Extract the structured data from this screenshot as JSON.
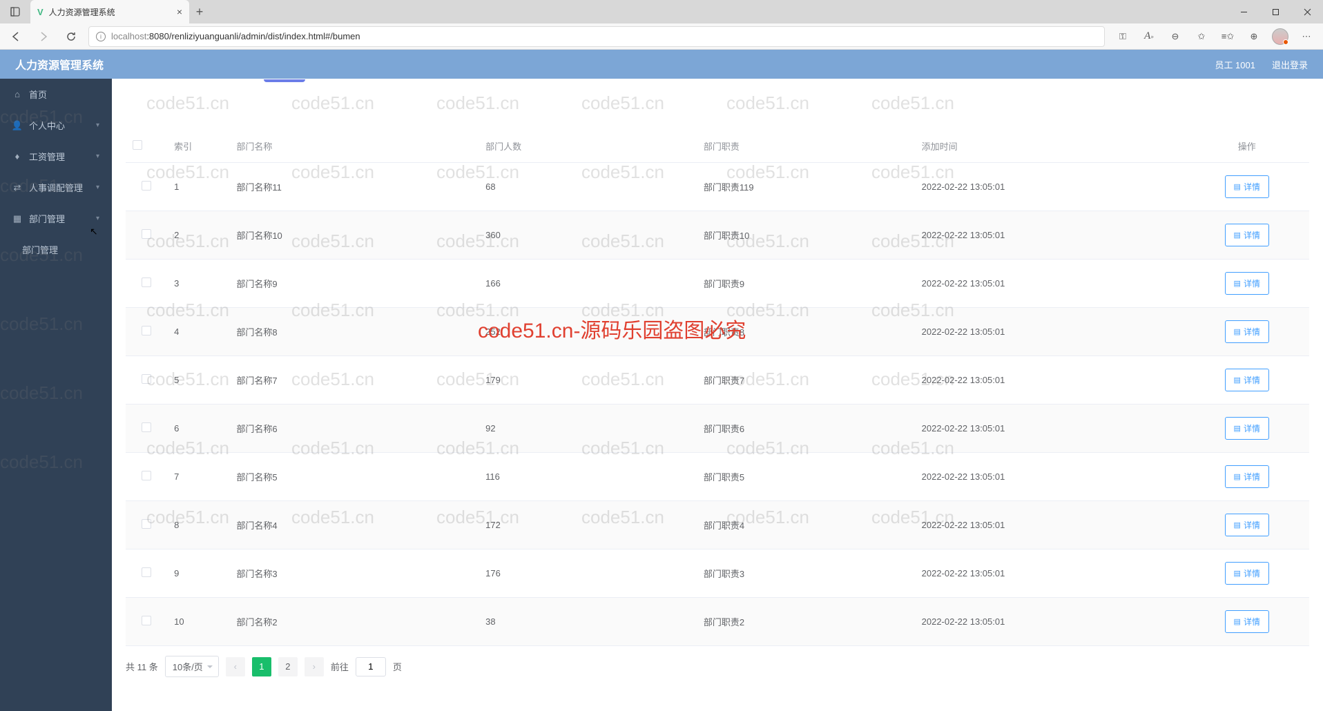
{
  "browser": {
    "tab_title": "人力资源管理系统",
    "url_host": "localhost",
    "url_port_path": ":8080/renliziyuanguanli/admin/dist/index.html#/bumen"
  },
  "header": {
    "app_title": "人力资源管理系统",
    "user_label": "员工 1001",
    "logout": "退出登录"
  },
  "sidebar": {
    "items": [
      {
        "label": "首页",
        "icon": "home"
      },
      {
        "label": "个人中心",
        "icon": "user"
      },
      {
        "label": "工资管理",
        "icon": "money"
      },
      {
        "label": "人事调配管理",
        "icon": "swap"
      },
      {
        "label": "部门管理",
        "icon": "dept"
      }
    ],
    "sub_item": {
      "label": "部门管理"
    }
  },
  "table": {
    "headers": {
      "index": "索引",
      "name": "部门名称",
      "count": "部门人数",
      "duty": "部门职责",
      "time": "添加时间",
      "action": "操作"
    },
    "detail_button": "详情",
    "rows": [
      {
        "idx": "1",
        "name": "部门名称11",
        "count": "68",
        "duty": "部门职责119",
        "time": "2022-02-22 13:05:01"
      },
      {
        "idx": "2",
        "name": "部门名称10",
        "count": "360",
        "duty": "部门职责10",
        "time": "2022-02-22 13:05:01"
      },
      {
        "idx": "3",
        "name": "部门名称9",
        "count": "166",
        "duty": "部门职责9",
        "time": "2022-02-22 13:05:01"
      },
      {
        "idx": "4",
        "name": "部门名称8",
        "count": "252",
        "duty": "部门职责8",
        "time": "2022-02-22 13:05:01"
      },
      {
        "idx": "5",
        "name": "部门名称7",
        "count": "179",
        "duty": "部门职责7",
        "time": "2022-02-22 13:05:01"
      },
      {
        "idx": "6",
        "name": "部门名称6",
        "count": "92",
        "duty": "部门职责6",
        "time": "2022-02-22 13:05:01"
      },
      {
        "idx": "7",
        "name": "部门名称5",
        "count": "116",
        "duty": "部门职责5",
        "time": "2022-02-22 13:05:01"
      },
      {
        "idx": "8",
        "name": "部门名称4",
        "count": "172",
        "duty": "部门职责4",
        "time": "2022-02-22 13:05:01"
      },
      {
        "idx": "9",
        "name": "部门名称3",
        "count": "176",
        "duty": "部门职责3",
        "time": "2022-02-22 13:05:01"
      },
      {
        "idx": "10",
        "name": "部门名称2",
        "count": "38",
        "duty": "部门职责2",
        "time": "2022-02-22 13:05:01"
      }
    ]
  },
  "pagination": {
    "total": "共 11 条",
    "page_size": "10条/页",
    "pages": [
      "1",
      "2"
    ],
    "goto_label": "前往",
    "goto_value": "1",
    "goto_suffix": "页"
  },
  "watermark": {
    "small": "code51.cn",
    "big": "code51.cn-源码乐园盗图必究"
  }
}
